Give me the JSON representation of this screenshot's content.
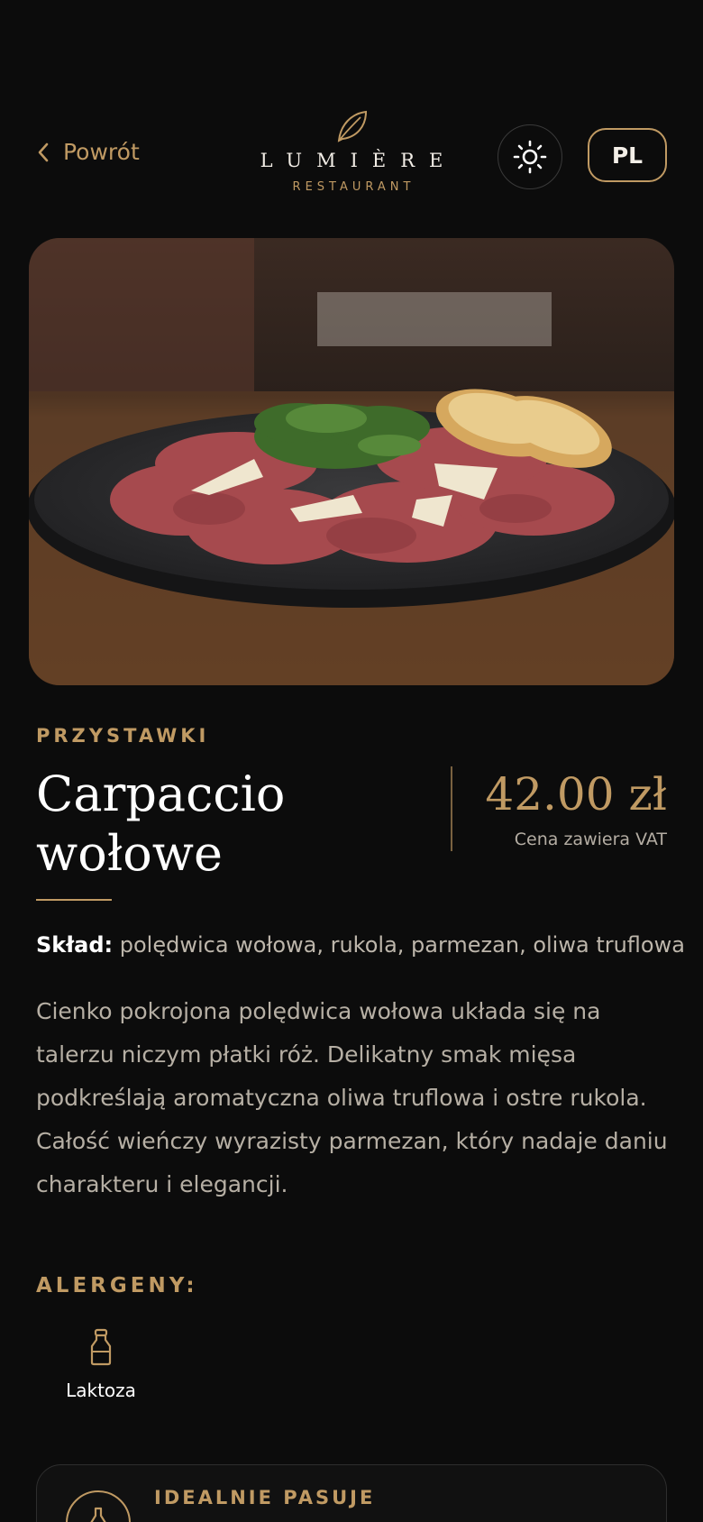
{
  "header": {
    "back_label": "Powrót",
    "logo_name": "LUMIÈRE",
    "logo_sub": "RESTAURANT",
    "theme_icon": "sun-icon",
    "language": "PL"
  },
  "dish": {
    "category": "PRZYSTAWKI",
    "title": "Carpaccio wołowe",
    "price": "42.00 zł",
    "vat_note": "Cena zawiera VAT",
    "ingredients_label": "Skład:",
    "ingredients": "polędwica wołowa, rukola, parmezan, oliwa truflowa",
    "description": "Cienko pokrojona polędwica wołowa układa się na talerzu niczym płatki róż. Delikatny smak mięsa podkreślają aromatyczna oliwa truflowa i ostre rukola. Całość wieńczy wyrazisty parmezan, który nadaje daniu charakteru i elegancji."
  },
  "allergens": {
    "title": "ALERGENY:",
    "items": [
      {
        "label": "Laktoza",
        "icon": "milk-bottle-icon"
      }
    ]
  },
  "pairing": {
    "title": "IDEALNIE PASUJE",
    "icon": "wine-bottle-icon"
  },
  "colors": {
    "background": "#0c0c0c",
    "accent_gold": "#c09a63",
    "text_primary": "#ffffff",
    "text_secondary": "#b6afa4"
  }
}
